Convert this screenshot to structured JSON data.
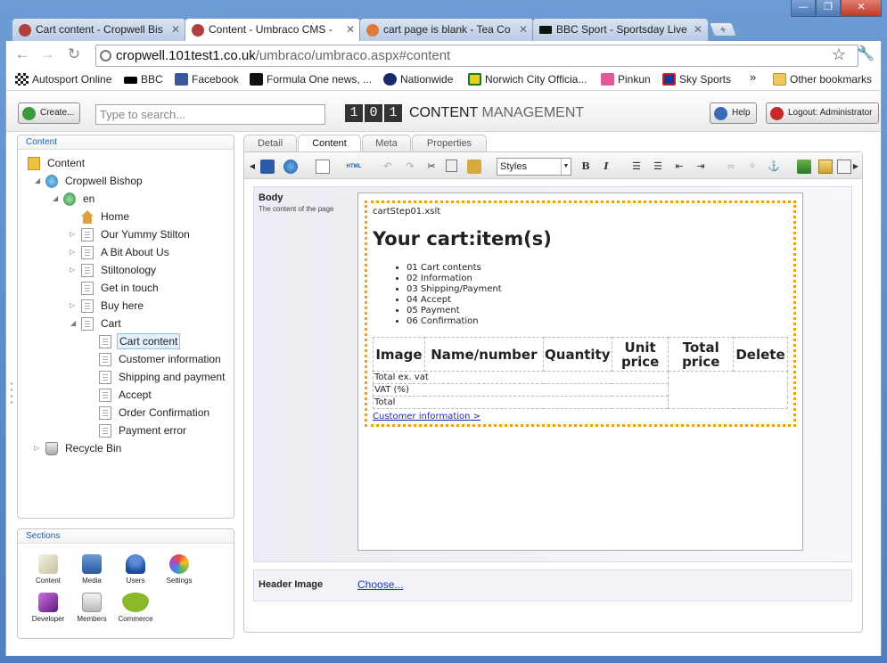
{
  "browser": {
    "tabs": [
      {
        "title": "Cart content - Cropwell Bis",
        "active": false
      },
      {
        "title": "Content - Umbraco CMS -",
        "active": true
      },
      {
        "title": "cart page is blank - Tea Co",
        "active": false
      },
      {
        "title": "BBC Sport - Sportsday Live",
        "active": false
      }
    ],
    "new_tab": "+",
    "url_domain": "cropwell.101test1.co.uk",
    "url_path": "/umbraco/umbraco.aspx#content",
    "bookmarks": [
      {
        "label": "Autosport Online",
        "color": "#222222"
      },
      {
        "label": "BBC",
        "color": "#000000"
      },
      {
        "label": "Facebook",
        "color": "#3b5998"
      },
      {
        "label": "Formula One news, ...",
        "color": "#111111"
      },
      {
        "label": "Nationwide",
        "color": "#1b2a6b"
      },
      {
        "label": "Norwich City Officia...",
        "color": "#1a7a1a"
      },
      {
        "label": "Pinkun",
        "color": "#e05a9a"
      },
      {
        "label": "Sky Sports",
        "color": "#1a3a9a"
      }
    ],
    "bookmarks_more": "»",
    "other_bookmarks": "Other bookmarks"
  },
  "header": {
    "create_label": "Create...",
    "search_placeholder": "Type to search...",
    "logo_digits": [
      "1",
      "0",
      "1"
    ],
    "logo_bold": "CONTENT",
    "logo_light": "MANAGEMENT",
    "help_label": "Help",
    "logout_label": "Logout: Administrator"
  },
  "tree": {
    "title": "Content",
    "nodes": {
      "content": "Content",
      "site": "Cropwell Bishop",
      "lang": "en",
      "home": "Home",
      "stilton": "Our Yummy Stilton",
      "about": "A Bit About Us",
      "stiltonology": "Stiltonology",
      "contact": "Get in touch",
      "buy": "Buy here",
      "cart": "Cart",
      "cart_content": "Cart content",
      "customer_info": "Customer information",
      "shipping": "Shipping and payment",
      "accept": "Accept",
      "order_confirm": "Order Confirmation",
      "payment_error": "Payment error",
      "recycle": "Recycle Bin"
    }
  },
  "sections": {
    "title": "Sections",
    "items": [
      {
        "label": "Content",
        "color": "#d8d0b8"
      },
      {
        "label": "Media",
        "color": "#3d6fb0"
      },
      {
        "label": "Users",
        "color": "#2a5fa8"
      },
      {
        "label": "Settings",
        "color": "#6cb84c"
      },
      {
        "label": "Developer",
        "color": "#8a3aa8"
      },
      {
        "label": "Members",
        "color": "#c8c8c8"
      },
      {
        "label": "Commerce",
        "color": "#8ab82a"
      }
    ]
  },
  "editor": {
    "tabs": [
      "Detail",
      "Content",
      "Meta",
      "Properties"
    ],
    "styles_label": "Styles",
    "body_label": "Body",
    "body_desc": "The content of the page",
    "macro_name": "cartStep01.xslt",
    "cart_heading": "Your cart:item(s)",
    "steps": [
      "01 Cart contents",
      "02 Information",
      "03 Shipping/Payment",
      "04 Accept",
      "05 Payment",
      "06 Confirmation"
    ],
    "columns": [
      "Image",
      "Name/number",
      "Quantity",
      "Unit price",
      "Total price",
      "Delete"
    ],
    "total_ex_vat": "Total ex. vat",
    "vat": "VAT (%)",
    "total": "Total",
    "next_link": "Customer information >",
    "header_image_label": "Header Image",
    "choose_link": "Choose..."
  }
}
